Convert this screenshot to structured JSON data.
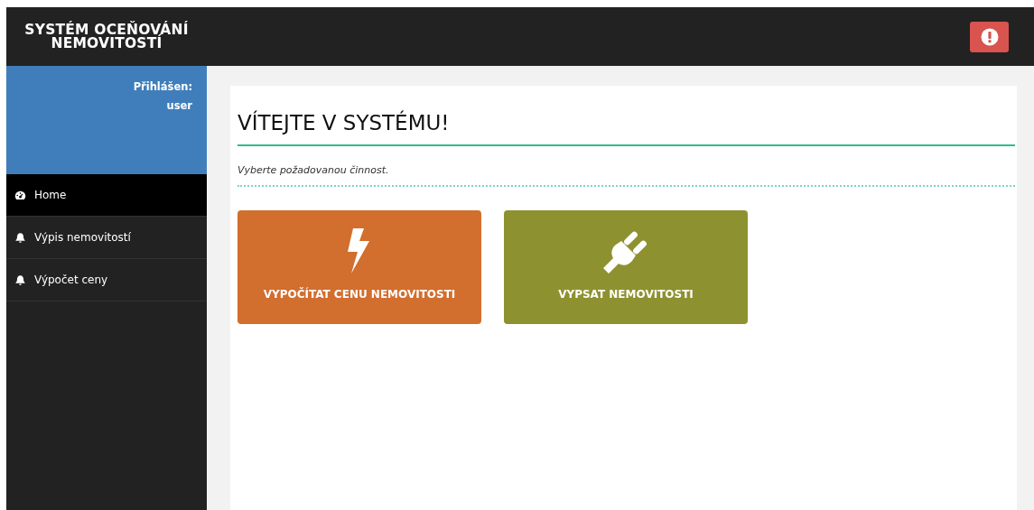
{
  "app_title": "SYSTÉM OCEŇOVÁNÍ NEMOVITOSTÍ",
  "user_panel": {
    "label": "Přihlášen:",
    "username": "user"
  },
  "sidebar": {
    "items": [
      {
        "label": "Home",
        "selected": true
      },
      {
        "label": "Výpis nemovitostí",
        "selected": false
      },
      {
        "label": "Výpočet ceny",
        "selected": false
      }
    ]
  },
  "page": {
    "heading": "VÍTEJTE V SYSTÉMU!",
    "subtitle": "Vyberte požadovanou činnost.",
    "tiles": [
      {
        "label": "VYPOČÍTAT CENU NEMOVITOSTI",
        "color": "#d26e2e"
      },
      {
        "label": "VYPSAT NEMOVITOSTI",
        "color": "#8e912f"
      }
    ]
  }
}
